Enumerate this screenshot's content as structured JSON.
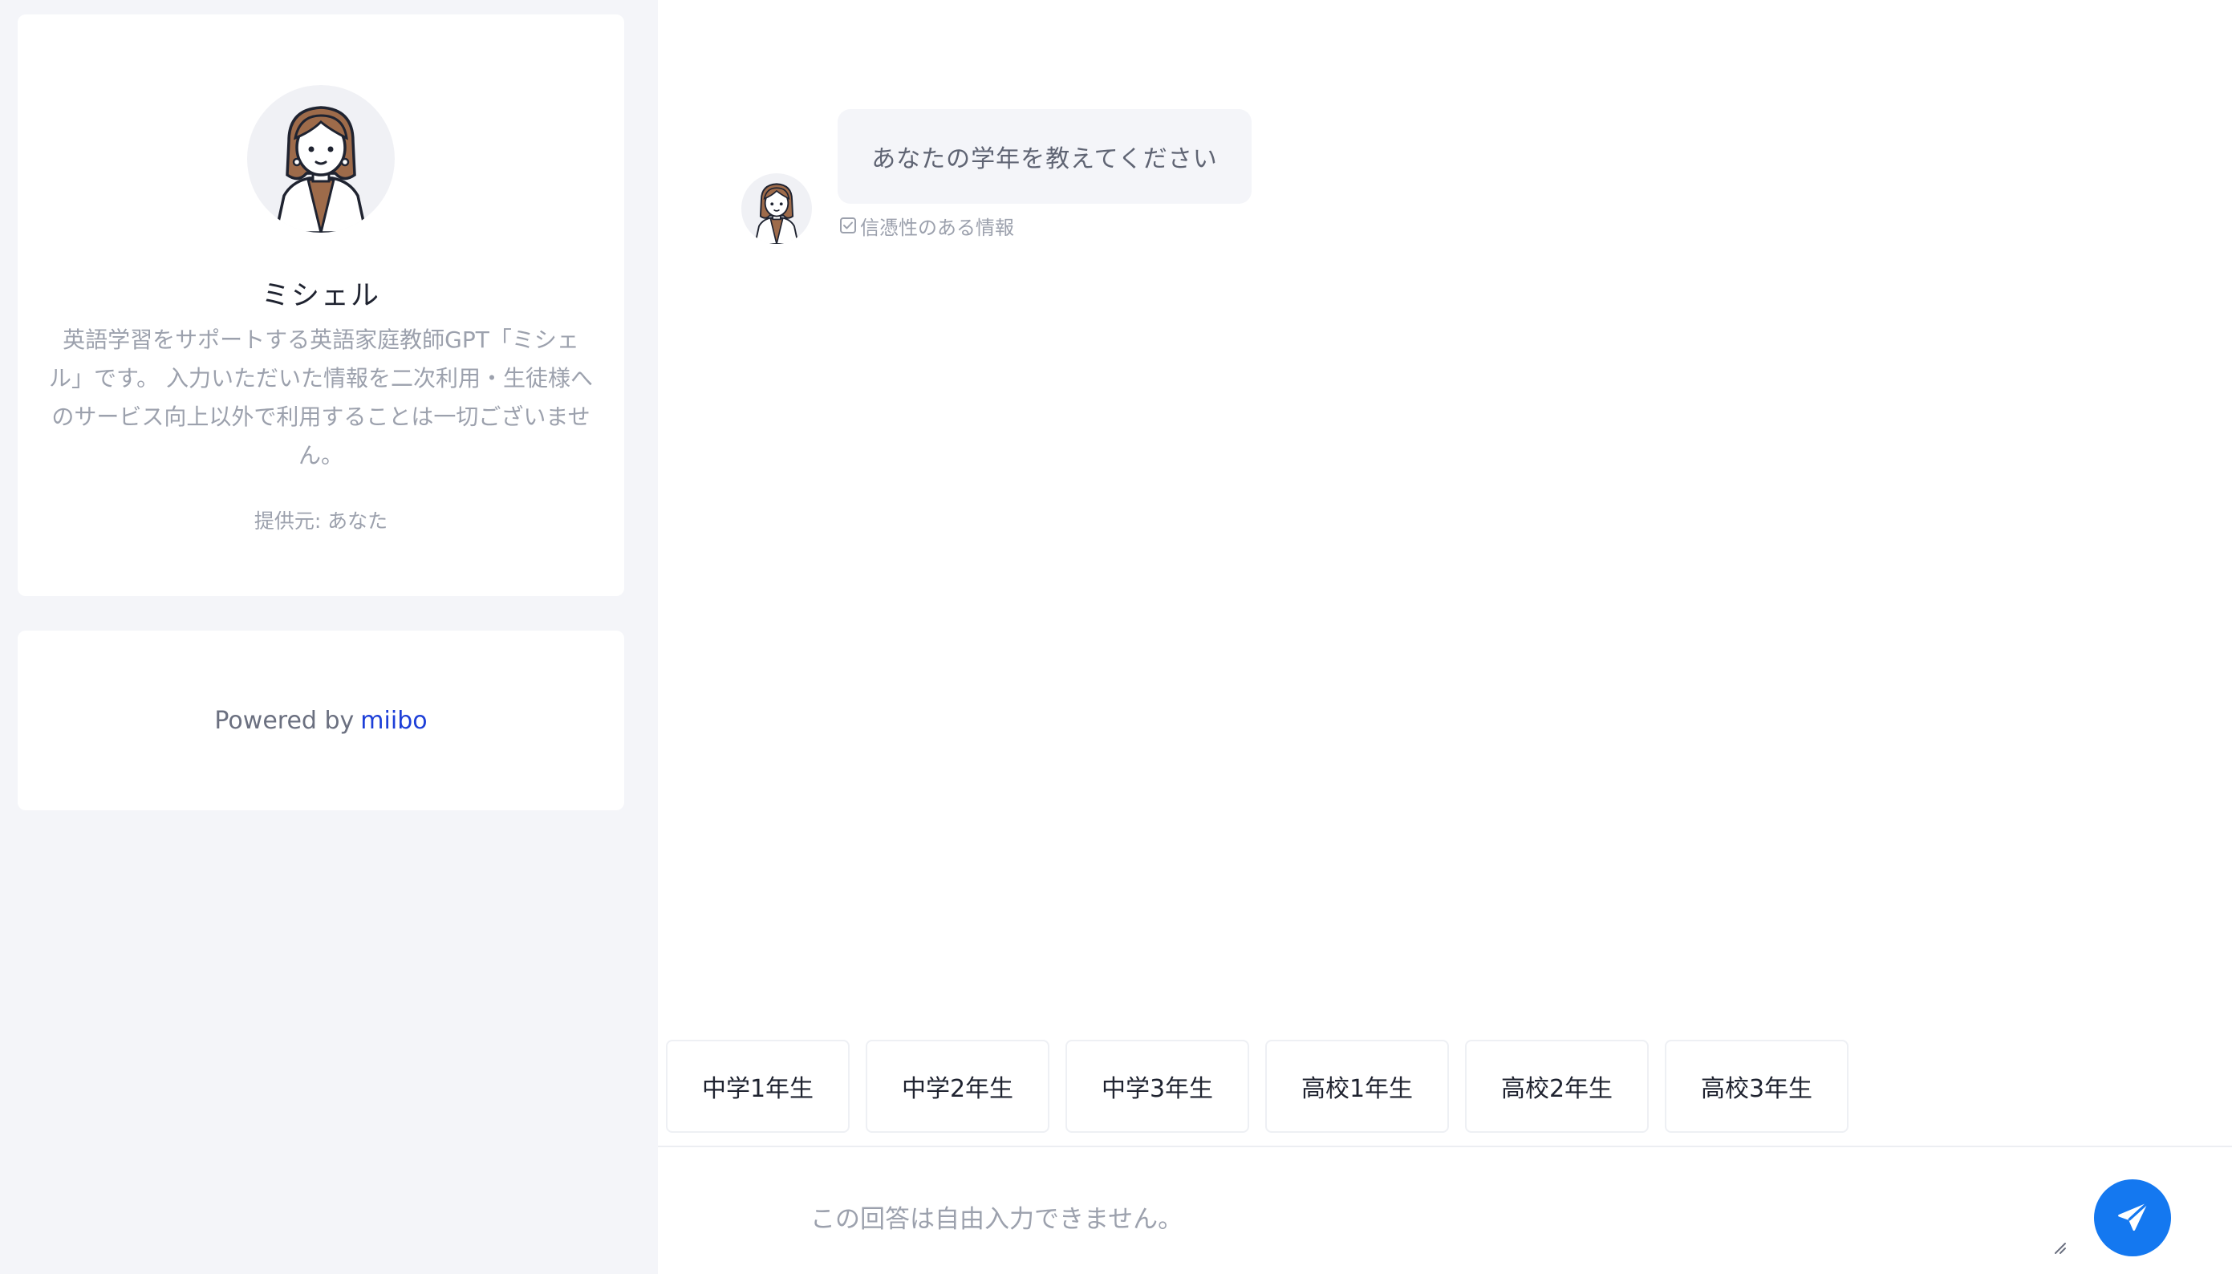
{
  "sidebar": {
    "bot_name": "ミシェル",
    "bot_description": "英語学習をサポートする英語家庭教師GPT「ミシェル」です。 入力いただいた情報を二次利用・生徒様へのサービス向上以外で利用することは一切ございません。",
    "provider": "提供元: あなた",
    "powered_by_prefix": "Powered by",
    "powered_by_link": "miibo"
  },
  "chat": {
    "messages": [
      {
        "sender": "bot",
        "text": "あなたの学年を教えてください",
        "note": "信憑性のある情報"
      }
    ],
    "choices": [
      "中学1年生",
      "中学2年生",
      "中学3年生",
      "高校1年生",
      "高校2年生",
      "高校3年生"
    ],
    "input": {
      "placeholder": "この回答は自由入力できません。",
      "value": ""
    }
  },
  "colors": {
    "accent": "#1478f0",
    "link": "#1d3fd8",
    "sidebar_bg": "#f4f5f9",
    "bubble_bg": "#f4f5f9"
  }
}
